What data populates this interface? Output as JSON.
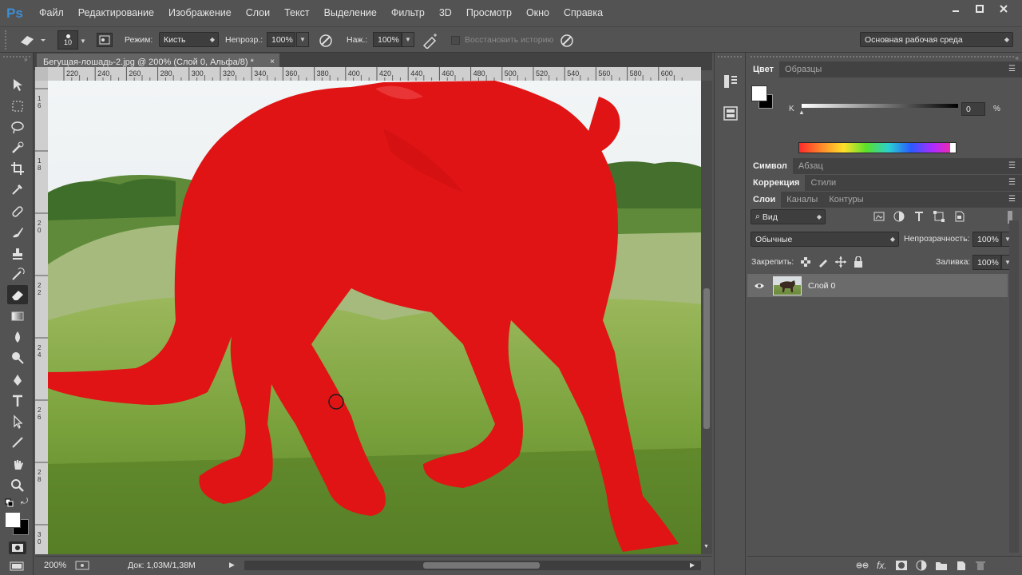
{
  "app": {
    "logo": "Ps"
  },
  "menu": [
    "Файл",
    "Редактирование",
    "Изображение",
    "Слои",
    "Текст",
    "Выделение",
    "Фильтр",
    "3D",
    "Просмотр",
    "Окно",
    "Справка"
  ],
  "window_controls": {
    "minimize_icon": "minimize-icon",
    "maximize_icon": "maximize-icon",
    "close_icon": "close-icon"
  },
  "options": {
    "brush_size": "10",
    "mode_label": "Режим:",
    "mode_value": "Кисть",
    "opacity_label": "Непрозр.:",
    "opacity_value": "100%",
    "pressure_label": "Наж.:",
    "pressure_value": "100%",
    "restore_history": "Восстановить историю",
    "workspace": "Основная рабочая среда"
  },
  "document": {
    "tab_title": "Бегущая-лошадь-2.jpg @ 200% (Слой 0, Альфа/8) *",
    "close": "×",
    "ruler_ticks": [
      "220",
      "240",
      "260",
      "280",
      "300",
      "320",
      "340",
      "360",
      "380",
      "400",
      "420",
      "440",
      "460",
      "480",
      "500",
      "520",
      "540",
      "560",
      "580",
      "600"
    ],
    "quick_mask_color": "#e01414"
  },
  "status": {
    "zoom": "200%",
    "doc_info": "Док: 1,03M/1,38M"
  },
  "color_panel": {
    "tabs": [
      "Цвет",
      "Образцы"
    ],
    "channel_label": "K",
    "channel_value": "0",
    "percent": "%"
  },
  "symbol_panel": {
    "tabs": [
      "Символ",
      "Абзац"
    ]
  },
  "adjust_panel": {
    "tabs": [
      "Коррекция",
      "Стили"
    ]
  },
  "layers_panel": {
    "tabs": [
      "Слои",
      "Каналы",
      "Контуры"
    ],
    "filter_kind": "Вид",
    "blend_mode": "Обычные",
    "opacity_label": "Непрозрачность:",
    "opacity_value": "100%",
    "lock_label": "Закрепить:",
    "fill_label": "Заливка:",
    "fill_value": "100%",
    "layers": [
      {
        "name": "Слой 0",
        "visible": true
      }
    ]
  }
}
